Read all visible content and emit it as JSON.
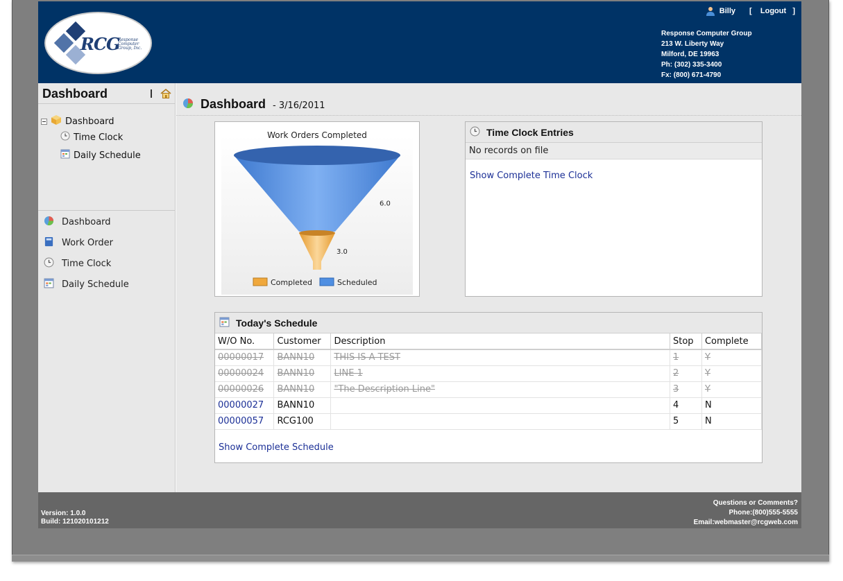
{
  "header": {
    "logo_text": "RCG",
    "logo_sub": [
      "Response",
      "Computer",
      "Group, Inc."
    ],
    "user_name": "Billy",
    "logout_label": "[    Logout   ]",
    "company_lines": [
      "Response Computer Group",
      "213 W. Liberty Way",
      "Milford, DE 19963",
      "Ph: (302) 335-3400",
      "Fx: (800) 671-4790"
    ]
  },
  "sidebar": {
    "title": "Dashboard",
    "tree": {
      "root": "Dashboard",
      "children": [
        "Time Clock",
        "Daily Schedule"
      ]
    },
    "nav": [
      "Dashboard",
      "Work Order",
      "Time Clock",
      "Daily Schedule"
    ]
  },
  "main": {
    "title": "Dashboard",
    "date": "- 3/16/2011"
  },
  "chart_panel": {
    "chart_data": {
      "type": "funnel",
      "title": "Work Orders Completed",
      "series": [
        {
          "name": "Scheduled",
          "value": 6.0,
          "color": "#4f8fe2"
        },
        {
          "name": "Completed",
          "value": 3.0,
          "color": "#f0a83c"
        }
      ],
      "data_labels": [
        "6.0",
        "3.0"
      ],
      "legend": [
        "Completed",
        "Scheduled"
      ],
      "legend_position": "bottom"
    }
  },
  "time_clock": {
    "title": "Time Clock Entries",
    "no_records": "No records on file",
    "link": "Show Complete Time Clock"
  },
  "schedule": {
    "title": "Today's Schedule",
    "columns": [
      "W/O No.",
      "Customer",
      "Description",
      "Stop",
      "Complete"
    ],
    "rows": [
      {
        "wo": "00000017",
        "customer": "BANN10",
        "description": "THIS IS A TEST",
        "stop": "1",
        "complete": "Y",
        "done": true
      },
      {
        "wo": "00000024",
        "customer": "BANN10",
        "description": "LINE 1",
        "stop": "2",
        "complete": "Y",
        "done": true
      },
      {
        "wo": "00000026",
        "customer": "BANN10",
        "description": "\"The Description Line\"",
        "stop": "3",
        "complete": "Y",
        "done": true
      },
      {
        "wo": "00000027",
        "customer": "BANN10",
        "description": "",
        "stop": "4",
        "complete": "N",
        "done": false
      },
      {
        "wo": "00000057",
        "customer": "RCG100",
        "description": "",
        "stop": "5",
        "complete": "N",
        "done": false
      }
    ],
    "link": "Show Complete Schedule"
  },
  "footer": {
    "version": "Version: 1.0.0",
    "build": "Build: 121020101212",
    "questions": "Questions or Comments?",
    "phone": "Phone:(800)555-5555",
    "email": "Email:webmaster@rcgweb.com"
  },
  "colors": {
    "header_bg": "#003366",
    "footer_bg": "#666666",
    "link": "#1b2f96",
    "scheduled": "#4f8fe2",
    "completed": "#f0a83c"
  }
}
